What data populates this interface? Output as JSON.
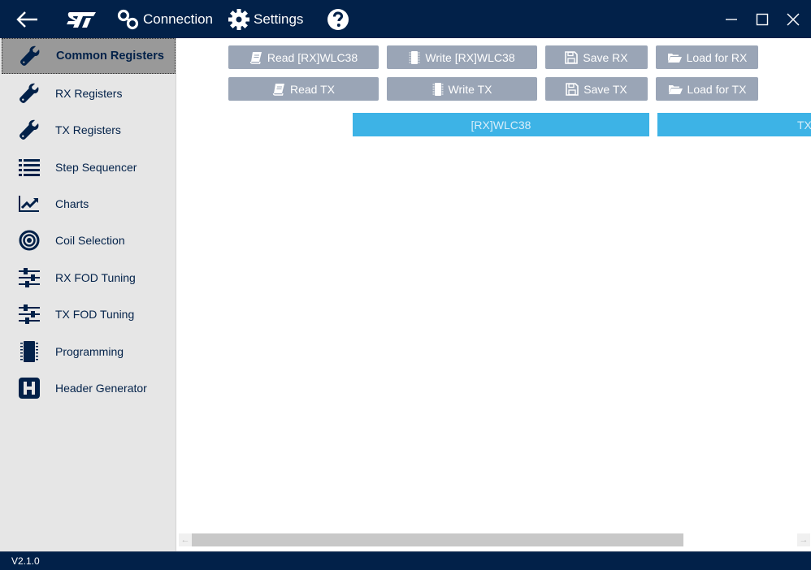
{
  "titlebar": {
    "connection_label": "Connection",
    "settings_label": "Settings"
  },
  "sidebar": {
    "items": [
      {
        "label": "Common Registers",
        "icon": "wrench-icon",
        "active": true
      },
      {
        "label": "RX Registers",
        "icon": "wrench-icon"
      },
      {
        "label": "TX Registers",
        "icon": "wrench-icon"
      },
      {
        "label": "Step Sequencer",
        "icon": "list-icon"
      },
      {
        "label": "Charts",
        "icon": "line-chart-icon"
      },
      {
        "label": "Coil Selection",
        "icon": "target-icon"
      },
      {
        "label": "RX FOD Tuning",
        "icon": "sliders-icon"
      },
      {
        "label": "TX FOD Tuning",
        "icon": "sliders-icon"
      },
      {
        "label": "Programming",
        "icon": "chip-icon"
      },
      {
        "label": "Header Generator",
        "icon": "h-square-icon"
      }
    ]
  },
  "toolbar": {
    "read_rx": "Read [RX]WLC38",
    "write_rx": "Write [RX]WLC38",
    "save_rx": "Save RX",
    "load_rx": "Load for RX",
    "read_tx": "Read TX",
    "write_tx": "Write TX",
    "save_tx": "Save TX",
    "load_tx": "Load for TX"
  },
  "tabs": [
    {
      "label": "[RX]WLC38"
    },
    {
      "label": "TX"
    }
  ],
  "status": {
    "version": "V2.1.0"
  },
  "colors": {
    "primary": "#022149",
    "button": "#9aa5b6",
    "tab": "#3db3e6"
  }
}
